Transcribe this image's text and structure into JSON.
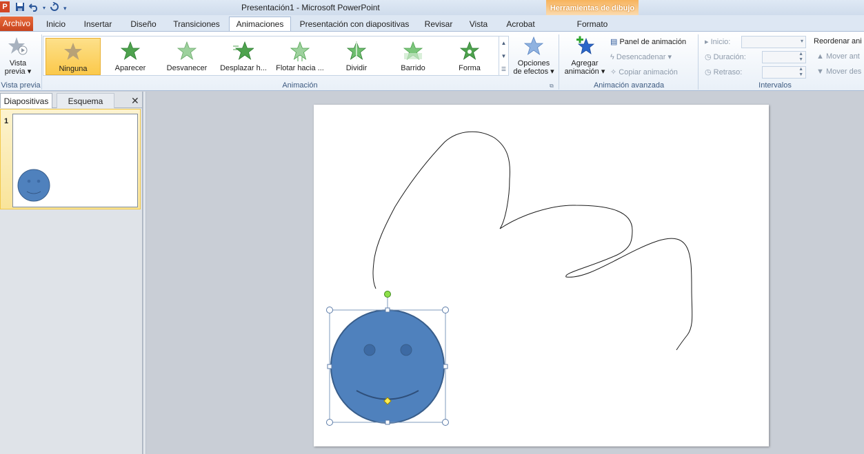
{
  "app": {
    "title": "Presentación1  -  Microsoft PowerPoint",
    "icon_letter": "P",
    "contextual_title": "Herramientas de dibujo"
  },
  "qat": {
    "icons": [
      "save-icon",
      "undo-icon",
      "dropdown-icon",
      "redo-icon",
      "customize-icon"
    ]
  },
  "tabs": {
    "file": "Archivo",
    "inicio": "Inicio",
    "insertar": "Insertar",
    "diseno": "Diseño",
    "transiciones": "Transiciones",
    "animaciones": "Animaciones",
    "presentacion": "Presentación con diapositivas",
    "revisar": "Revisar",
    "vista": "Vista",
    "acrobat": "Acrobat",
    "formato": "Formato"
  },
  "ribbon": {
    "vista_previa": {
      "line1": "Vista",
      "line2": "previa ▾",
      "group": "Vista previa"
    },
    "animacion_gallery": {
      "items": [
        "Ninguna",
        "Aparecer",
        "Desvanecer",
        "Desplazar h...",
        "Flotar hacia ...",
        "Dividir",
        "Barrido",
        "Forma"
      ],
      "selected": "Ninguna"
    },
    "opciones": {
      "line1": "Opciones",
      "line2": "de efectos ▾"
    },
    "group_animacion": "Animación",
    "agregar": {
      "line1": "Agregar",
      "line2": "animación ▾"
    },
    "panel": "Panel de animación",
    "desencadenar": "Desencadenar ▾",
    "copiar": "Copiar animación",
    "group_avanzada": "Animación avanzada",
    "inicio_label": "Inicio:",
    "duracion_label": "Duración:",
    "retraso_label": "Retraso:",
    "group_intervalos": "Intervalos",
    "reordenar": "Reordenar ani",
    "mover_ant": "Mover ant",
    "mover_des": "Mover des"
  },
  "left_panel": {
    "tab_diapositivas": "Diapositivas",
    "tab_esquema": "Esquema",
    "close": "✕",
    "slide_number": "1"
  },
  "colors": {
    "smiley_fill": "#4f81bd",
    "smiley_stroke": "#385d8a",
    "accent_orange": "#f7b35c",
    "file_tab": "#d24726"
  }
}
